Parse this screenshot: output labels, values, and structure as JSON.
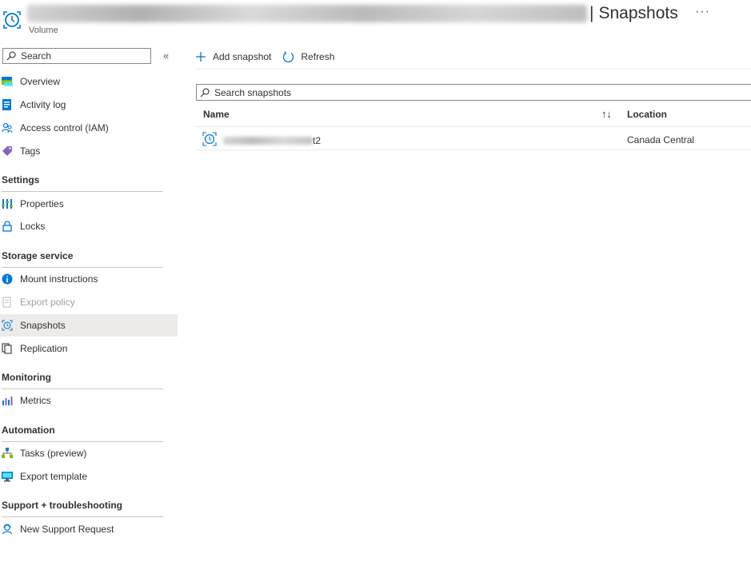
{
  "header": {
    "separator": "|",
    "title": "Snapshots",
    "subtitle": "Volume",
    "more": "···"
  },
  "sidebar": {
    "search_placeholder": "Search",
    "collapse_glyph": "«",
    "items_top": [
      {
        "label": "Overview",
        "icon": "overview-icon"
      },
      {
        "label": "Activity log",
        "icon": "activity-log-icon"
      },
      {
        "label": "Access control (IAM)",
        "icon": "people-icon"
      },
      {
        "label": "Tags",
        "icon": "tag-icon"
      }
    ],
    "sections": [
      {
        "title": "Settings",
        "items": [
          {
            "label": "Properties",
            "icon": "properties-icon"
          },
          {
            "label": "Locks",
            "icon": "lock-icon"
          }
        ]
      },
      {
        "title": "Storage service",
        "items": [
          {
            "label": "Mount instructions",
            "icon": "info-icon"
          },
          {
            "label": "Export policy",
            "icon": "export-policy-icon",
            "disabled": true
          },
          {
            "label": "Snapshots",
            "icon": "snapshot-icon",
            "selected": true
          },
          {
            "label": "Replication",
            "icon": "replication-icon"
          }
        ]
      },
      {
        "title": "Monitoring",
        "items": [
          {
            "label": "Metrics",
            "icon": "metrics-icon"
          }
        ]
      },
      {
        "title": "Automation",
        "items": [
          {
            "label": "Tasks (preview)",
            "icon": "tasks-icon"
          },
          {
            "label": "Export template",
            "icon": "export-template-icon"
          }
        ]
      },
      {
        "title": "Support + troubleshooting",
        "items": [
          {
            "label": "New Support Request",
            "icon": "support-icon"
          }
        ]
      }
    ]
  },
  "toolbar": {
    "add_label": "Add snapshot",
    "refresh_label": "Refresh"
  },
  "grid": {
    "search_placeholder": "Search snapshots",
    "col_name": "Name",
    "sort_glyph": "↑↓",
    "col_location": "Location",
    "rows": [
      {
        "name_suffix": "t2",
        "location": "Canada Central"
      }
    ]
  },
  "colors": {
    "accent": "#0078d4",
    "selected_bg": "#edebe9",
    "divider": "#c8c6c4"
  }
}
